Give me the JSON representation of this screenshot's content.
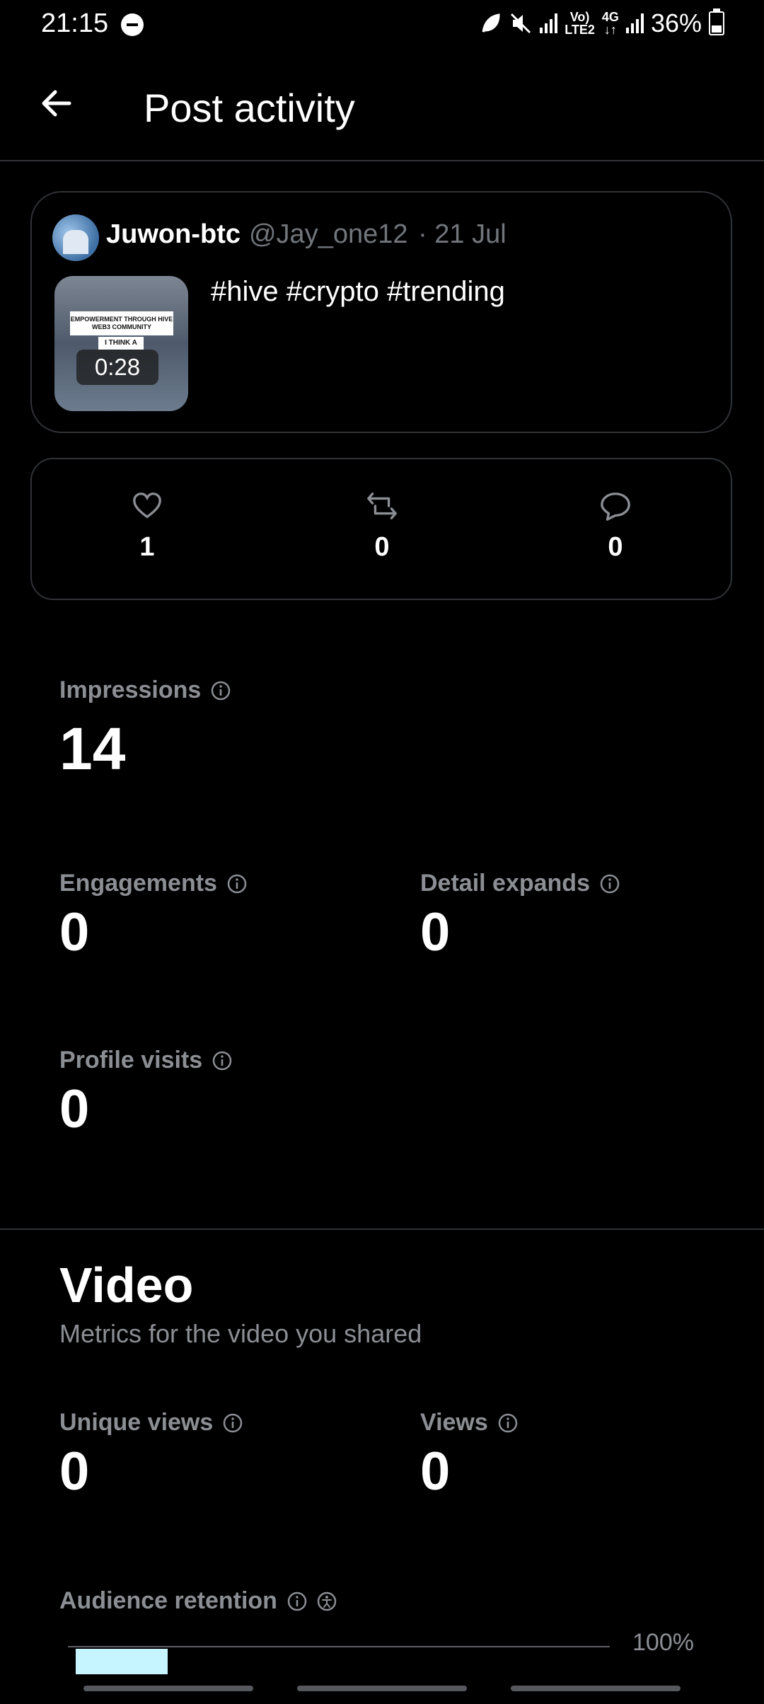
{
  "status_bar": {
    "time": "21:15",
    "battery": "36%",
    "net_top": "Vo)",
    "net_bottom": "LTE2",
    "gen": "4G"
  },
  "header": {
    "title": "Post activity"
  },
  "post": {
    "author": "Juwon-btc",
    "handle": "@Jay_one12",
    "date": "· 21 Jul",
    "text": "#hive #crypto #trending",
    "thumbnail_caption": "EMPOWERMENT THROUGH HIVE WEB3 COMMUNITY",
    "thumbnail_subcaption": "I THINK A",
    "video_duration": "0:28"
  },
  "engagement": {
    "likes": "1",
    "reposts": "0",
    "replies": "0"
  },
  "metrics": {
    "impressions": {
      "label": "Impressions",
      "value": "14"
    },
    "engagements": {
      "label": "Engagements",
      "value": "0"
    },
    "detail_expands": {
      "label": "Detail expands",
      "value": "0"
    },
    "profile_visits": {
      "label": "Profile visits",
      "value": "0"
    }
  },
  "video": {
    "title": "Video",
    "subtitle": "Metrics for the video you shared",
    "unique_views": {
      "label": "Unique views",
      "value": "0"
    },
    "views": {
      "label": "Views",
      "value": "0"
    },
    "audience_retention": {
      "label": "Audience retention",
      "max_label": "100%",
      "bar_fraction": 0.17
    }
  },
  "colors": {
    "accent_retention": "#c6f4ff",
    "muted_text": "#8b8f94",
    "border": "#2f3336"
  },
  "icons": [
    "back-arrow-icon",
    "heart-icon",
    "repost-icon",
    "reply-icon",
    "info-icon",
    "accessibility-icon"
  ]
}
